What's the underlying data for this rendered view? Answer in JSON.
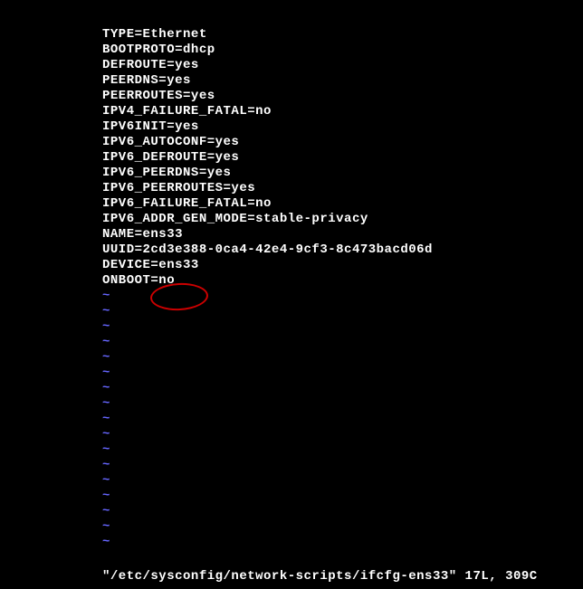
{
  "config_lines": [
    "TYPE=Ethernet",
    "BOOTPROTO=dhcp",
    "DEFROUTE=yes",
    "PEERDNS=yes",
    "PEERROUTES=yes",
    "IPV4_FAILURE_FATAL=no",
    "IPV6INIT=yes",
    "IPV6_AUTOCONF=yes",
    "IPV6_DEFROUTE=yes",
    "IPV6_PEERDNS=yes",
    "IPV6_PEERROUTES=yes",
    "IPV6_FAILURE_FATAL=no",
    "IPV6_ADDR_GEN_MODE=stable-privacy",
    "NAME=ens33",
    "UUID=2cd3e388-0ca4-42e4-9cf3-8c473bacd06d",
    "DEVICE=ens33",
    "ONBOOT=no"
  ],
  "tilde": "~",
  "status_text": "\"/etc/sysconfig/network-scripts/ifcfg-ens33\" 17L, 309C",
  "annotation": {
    "target_line": 16,
    "description": "ONBOOT=no circled"
  }
}
